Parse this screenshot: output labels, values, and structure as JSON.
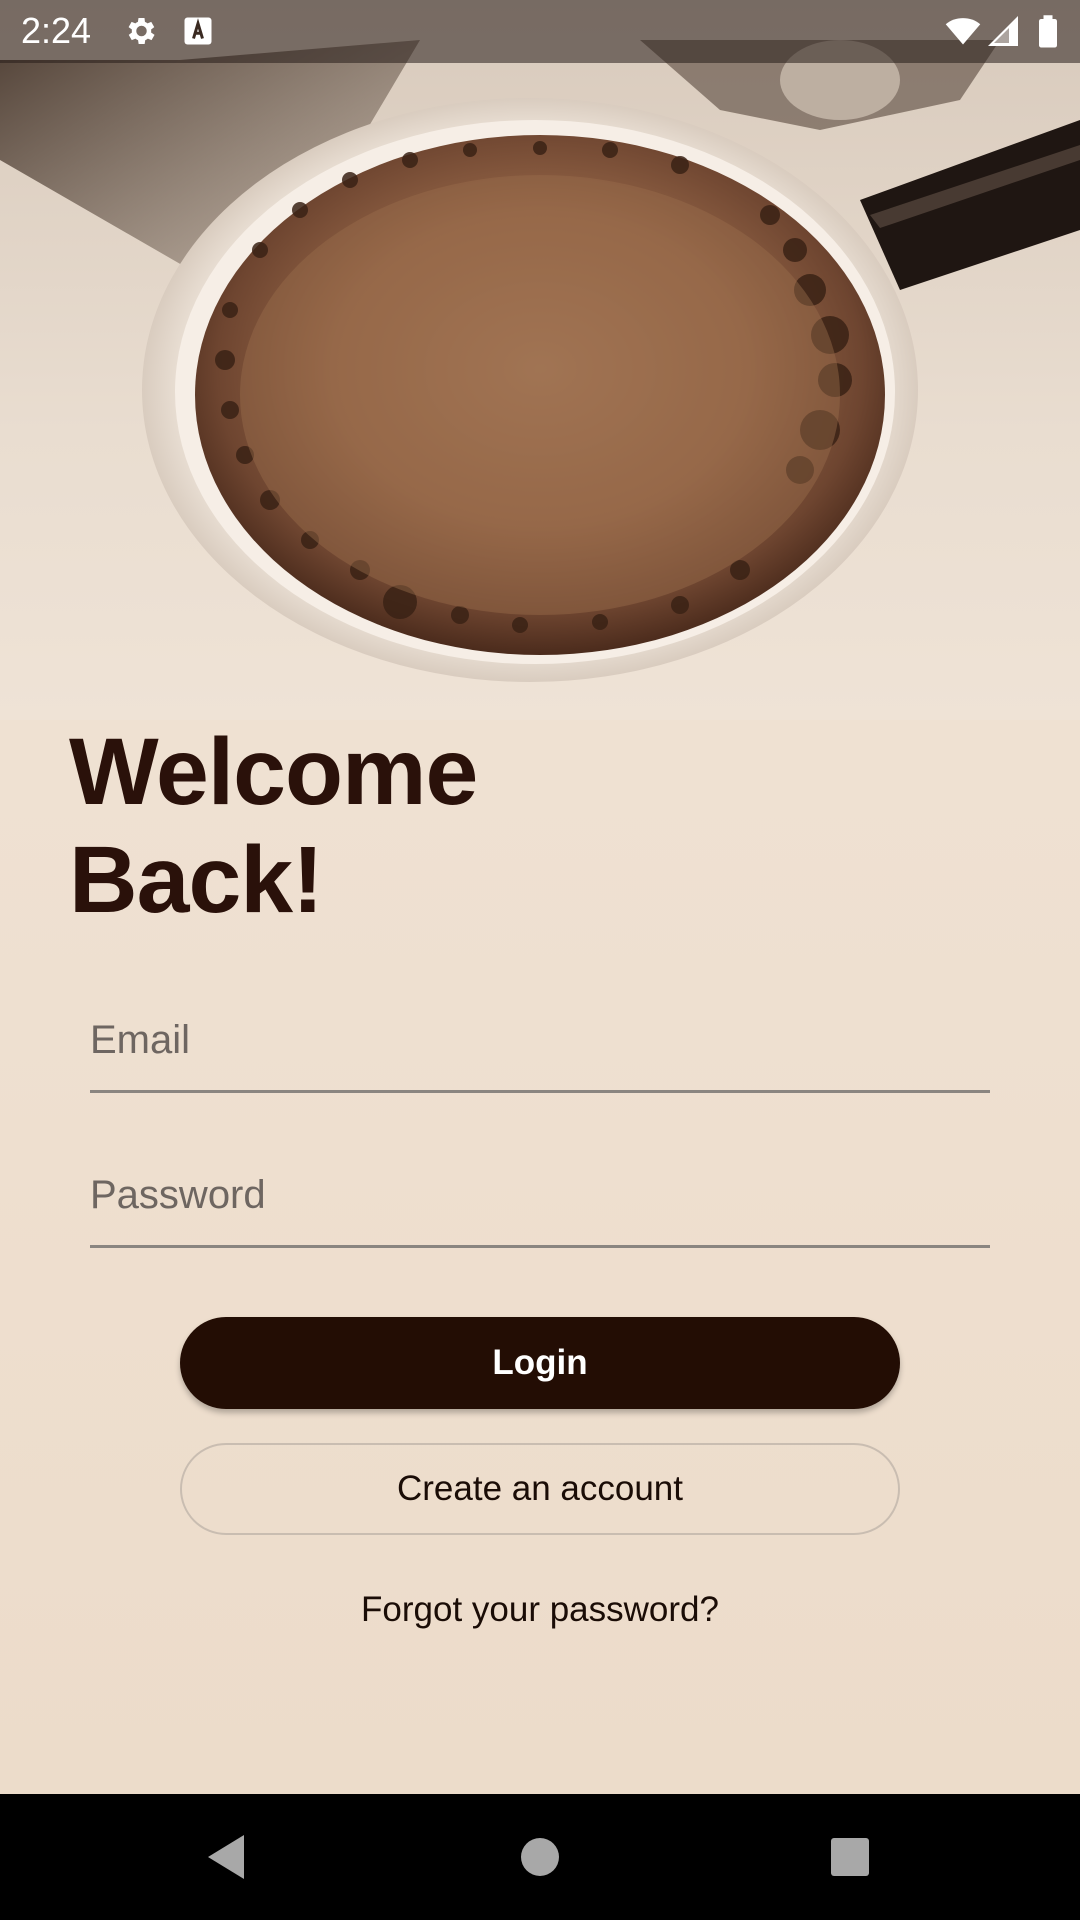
{
  "status_bar": {
    "time": "2:24",
    "icons": [
      "gear-icon",
      "keyboard-a-icon",
      "wifi-icon",
      "signal-icon",
      "battery-icon"
    ]
  },
  "hero": {
    "image": "coffee-cup-photo"
  },
  "welcome": {
    "line1": "Welcome",
    "line2": "Back!"
  },
  "form": {
    "email_placeholder": "Email",
    "email_value": "",
    "password_placeholder": "Password",
    "password_value": ""
  },
  "actions": {
    "login_label": "Login",
    "create_account_label": "Create an account",
    "forgot_password_label": "Forgot your password?"
  },
  "nav": {
    "icons": [
      "back-icon",
      "home-icon",
      "recents-icon"
    ]
  },
  "colors": {
    "accent": "#230d04",
    "background": "#efe3d6",
    "title_text": "#2a110a"
  }
}
